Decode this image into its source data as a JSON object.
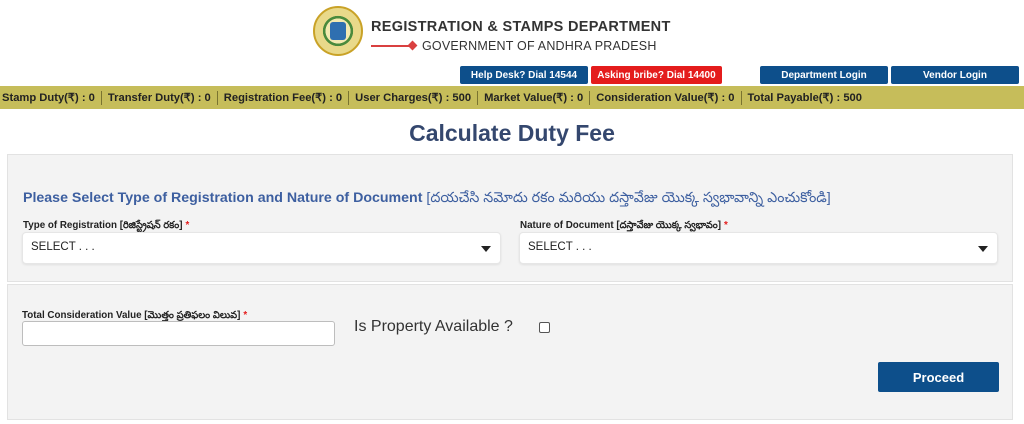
{
  "header": {
    "dept_title": "REGISTRATION & STAMPS DEPARTMENT",
    "gov_title": "GOVERNMENT OF ANDHRA PRADESH",
    "logo": "andhra-pradesh-emblem",
    "buttons": {
      "help": "Help Desk? Dial 14544",
      "bribe": "Asking bribe? Dial 14400",
      "department_login": "Department Login",
      "vendor_login": "Vendor Login"
    }
  },
  "fee_bar": [
    "Stamp Duty(₹) : 0",
    "Transfer Duty(₹) : 0",
    "Registration Fee(₹) : 0",
    "User Charges(₹) : 500",
    "Market Value(₹) : 0",
    "Consideration Value(₹) : 0",
    "Total Payable(₹) : 500"
  ],
  "page_title": "Calculate Duty Fee",
  "section": {
    "heading_en": "Please Select Type of Registration and Nature of Document",
    "heading_te": "[దయచేసి నమోదు రకం మరియు దస్తావేజు యొక్క స్వభావాన్ని ఎంచుకోండి]"
  },
  "fields": {
    "registration_type": {
      "label": "Type of Registration [రిజిస్ట్రేషన్ రకం]",
      "required": "*",
      "value": "SELECT . . ."
    },
    "nature_of_document": {
      "label": "Nature of Document [దస్తావేజు యొక్క స్వభావం]",
      "required": "*",
      "value": "SELECT . . ."
    },
    "consideration_value": {
      "label": "Total Consideration Value [మొత్తం ప్రతిఫలం విలువ]",
      "required": "*",
      "value": ""
    },
    "property_available": {
      "label": "Is Property Available ?"
    }
  },
  "actions": {
    "proceed": "Proceed"
  },
  "colors": {
    "primary": "#0d4f8b",
    "danger": "#e41c1c",
    "fee_bar": "#c6bd5a",
    "title": "#34476e",
    "heading": "#3d5fa0"
  }
}
